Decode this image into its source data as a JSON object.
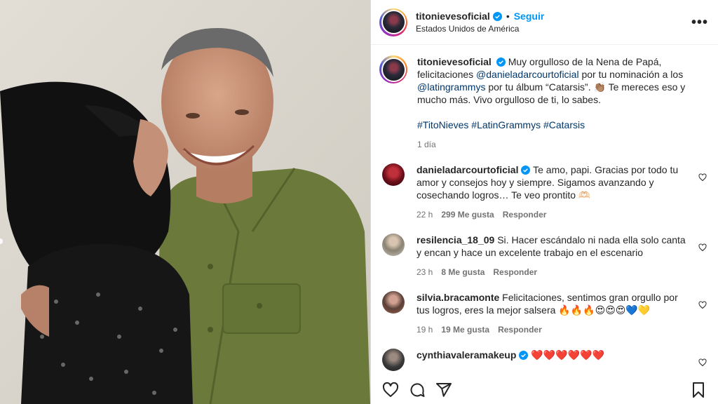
{
  "header": {
    "username": "titonievesoficial",
    "follow_label": "Seguir",
    "location": "Estados Unidos de América",
    "more_label": "•••"
  },
  "caption": {
    "username": "titonievesoficial",
    "text_1": "Muy orgulloso de la Nena de Papá, felicitaciones ",
    "mention_1": "@danieladarcourtoficial",
    "text_2": " por tu nominación a los ",
    "mention_2": "@latingrammys",
    "text_3": " por tu álbum “Catarsis”. 👏🏽 Te mereces eso y mucho más. Vivo orgulloso de ti, lo sabes.",
    "hashtags": "#TitoNieves #LatinGrammys #Catarsis",
    "time": "1 día"
  },
  "comments": [
    {
      "username": "danieladarcourtoficial",
      "text": "Te amo, papi. Gracias por todo tu amor y consejos hoy y siempre. Sigamos avanzando y cosechando logros… Te veo prontito 🫶🏻",
      "time": "22 h",
      "likes": "299 Me gusta",
      "reply": "Responder",
      "avatar_color": "#6b0f1a"
    },
    {
      "username": "resilencia_18_09",
      "text": "Si. Hacer escándalo ni nada ella solo canta y encan y hace un excelente trabajo en el escenario",
      "time": "23 h",
      "likes": "8 Me gusta",
      "reply": "Responder",
      "avatar_color": "#8a8274"
    },
    {
      "username": "silvia.bracamonte",
      "text": "Felicitaciones, sentimos gran orgullo por tus logros, eres la mejor salsera 🔥🔥🔥😍😍😍💙💛",
      "time": "19 h",
      "likes": "19 Me gusta",
      "reply": "Responder",
      "avatar_color": "#5a4038"
    },
    {
      "username": "cynthiavaleramakeup",
      "text": "❤️❤️❤️❤️❤️❤️",
      "avatar_color": "#3a3a3a"
    }
  ],
  "icons": {
    "like": "heart-icon",
    "comment": "comment-icon",
    "share": "share-icon",
    "save": "bookmark-icon"
  },
  "colors": {
    "accent": "#0095f6",
    "link": "#00376b",
    "muted": "#737373",
    "shirt": "#6b7a3a"
  }
}
